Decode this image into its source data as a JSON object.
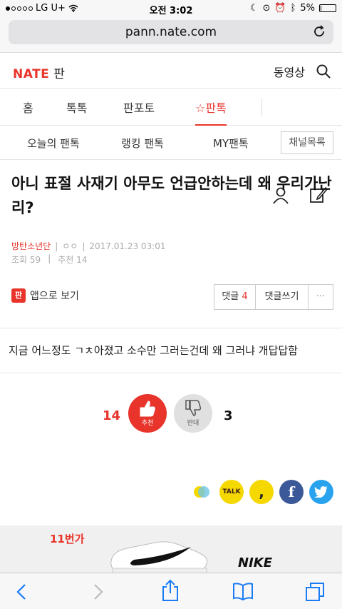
{
  "status_bar": {
    "carrier": "LG U+",
    "time": "오전 3:02",
    "battery": "5%",
    "battery_level": 0.05
  },
  "browser": {
    "url": "pann.nate.com"
  },
  "header": {
    "logo": "NATE",
    "section": "판",
    "video_link": "동영상"
  },
  "main_nav": {
    "items": [
      "홈",
      "톡톡",
      "판포토",
      "판톡"
    ]
  },
  "sub_nav": {
    "items": [
      "오늘의 팬톡",
      "랭킹 팬톡",
      "MY팬톡"
    ],
    "channel_button": "채널목록"
  },
  "article": {
    "title": "아니 표절 사재기 아무도 언급안하는데 왜 우리가난리?",
    "author": "방탄소년단",
    "author_extra": "ㅇㅇ",
    "datetime": "2017.01.23 03:01",
    "views_label": "조회",
    "views": "59",
    "recommend_label": "추천",
    "recommend": "14",
    "app_icon_text": "판",
    "app_view": "앱으로 보기",
    "comments_label": "댓글",
    "comments_count": "4",
    "write_comment": "댓글쓰기",
    "more": "···",
    "body": "지금 어느정도 ㄱㅊ아졌고 소수만 그러는건데 왜 그러냐 개답답함"
  },
  "votes": {
    "up_count": "14",
    "up_label": "추천",
    "down_label": "반대",
    "down_count": "3"
  },
  "share": {
    "kakaotalk": "TALK"
  },
  "ad": {
    "brand": "11번가",
    "logo": "NIKE"
  },
  "colors": {
    "accent": "#e8342b"
  }
}
